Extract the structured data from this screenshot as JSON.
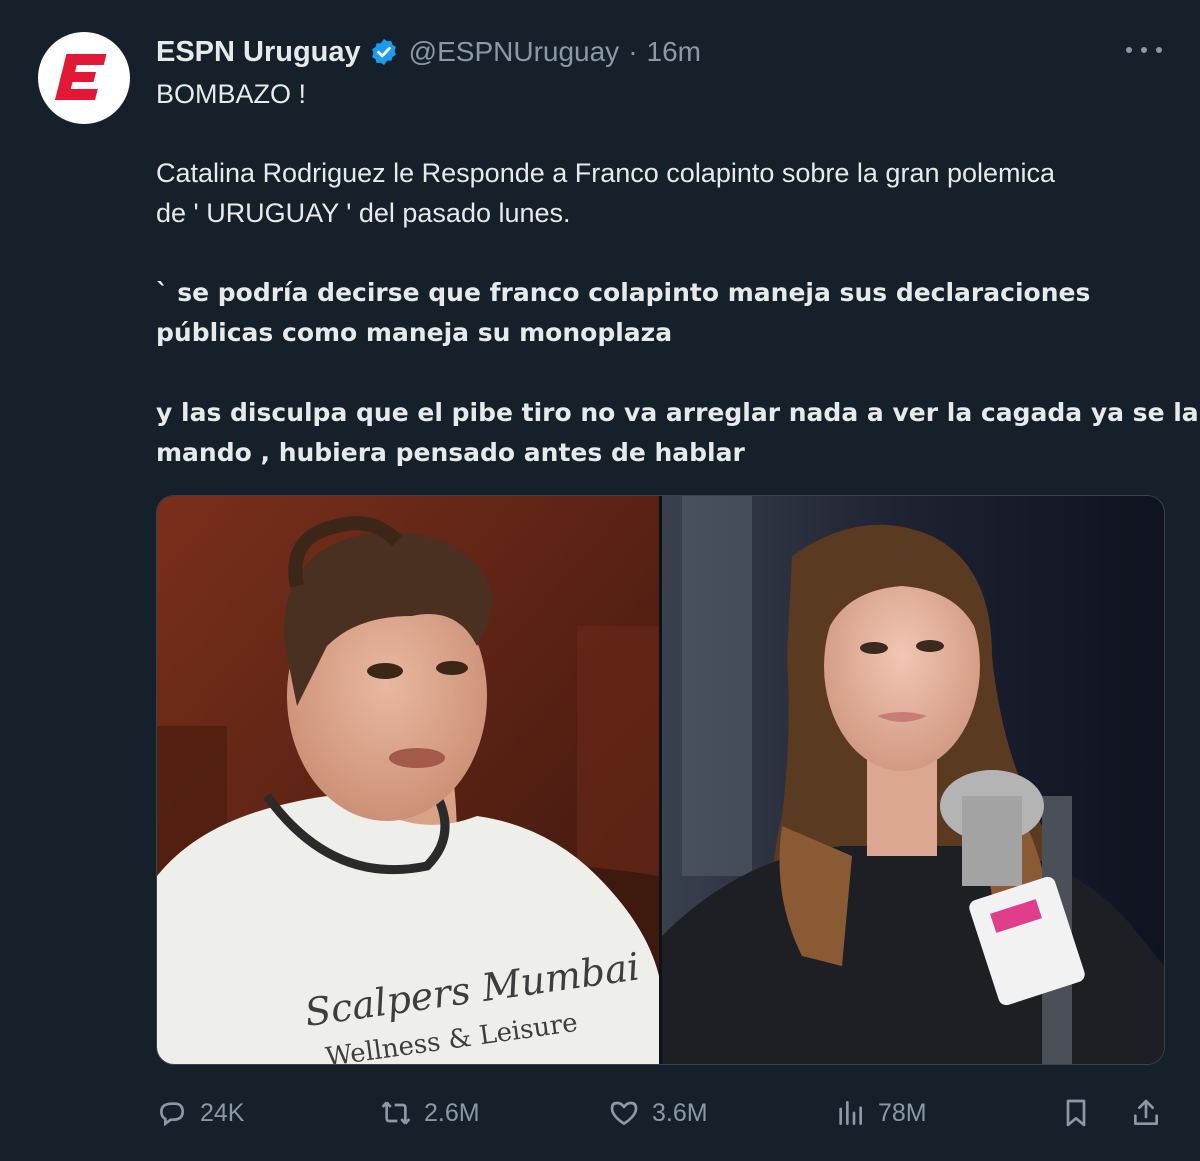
{
  "author": {
    "name": "ESPN Uruguay",
    "handle": "@ESPNUruguay",
    "separator": "·",
    "time": "16m",
    "verified": true,
    "avatar_icon": "espn-logo-icon",
    "brand_color": "#e31837",
    "verified_color": "#1d9bf0"
  },
  "tweet": {
    "line1": "BOMBAZO !",
    "line2": "Catalina Rodriguez le Responde a Franco colapinto sobre la gran polemica",
    "line3": "de ' URUGUAY ' del pasado lunes.",
    "line4": "` se podría decirse que franco colapinto maneja sus declaraciones",
    "line5": "públicas como maneja su monoplaza",
    "line6": "y las disculpa que el pibe tiro no va arreglar nada a ver la cagada ya se la",
    "line7": "mando , hubiera pensado antes de hablar"
  },
  "media": {
    "left_shirt_text_1": "Scalpers Mumbai",
    "left_shirt_text_2": "Wellness & Leisure"
  },
  "actions": {
    "replies": "24K",
    "reposts": "2.6M",
    "likes": "3.6M",
    "views": "78M"
  },
  "colors": {
    "background": "#15202b",
    "text": "#e7e9ea",
    "muted": "#8b98a5",
    "border": "#38444d"
  }
}
